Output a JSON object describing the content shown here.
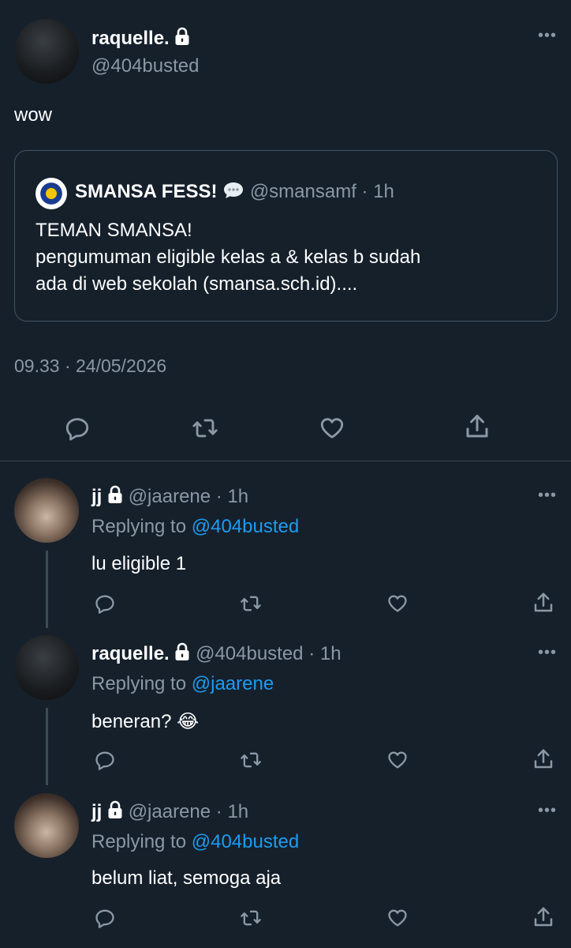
{
  "main_tweet": {
    "display_name": "raquelle.",
    "handle": "@404busted",
    "text": "wow",
    "timestamp": "09.33 · 24/05/2026",
    "quote": {
      "display_name": "SMANSA FESS!",
      "handle": "@smansamf",
      "time": "· 1h",
      "text_lines": [
        "TEMAN SMANSA!",
        "pengumuman eligible kelas a & kelas b sudah",
        "ada di web sekolah (smansa.sch.id)...."
      ]
    }
  },
  "replies": [
    {
      "display_name": "jj",
      "handle": "@jaarene",
      "time": "· 1h",
      "replying_prefix": "Replying to",
      "replying_to": "@404busted",
      "text": "lu eligible 1",
      "emoji": ""
    },
    {
      "display_name": "raquelle.",
      "handle": "@404busted",
      "time": "· 1h",
      "replying_prefix": "Replying to",
      "replying_to": "@jaarene",
      "text": "beneran?",
      "emoji": "😂"
    },
    {
      "display_name": "jj",
      "handle": "@jaarene",
      "time": "· 1h",
      "replying_prefix": "Replying to",
      "replying_to": "@404busted",
      "text": "belum liat, semoga aja",
      "emoji": ""
    }
  ],
  "icons": {
    "lock": "lock-icon",
    "reply": "reply-icon",
    "retweet": "retweet-icon",
    "like": "heart-icon",
    "share": "share-icon",
    "more": "more-icon",
    "speech": "speech-bubble-icon"
  },
  "colors": {
    "background": "#15202b",
    "muted": "#8b98a5",
    "link": "#1d9bf0",
    "divider": "#38444d"
  }
}
